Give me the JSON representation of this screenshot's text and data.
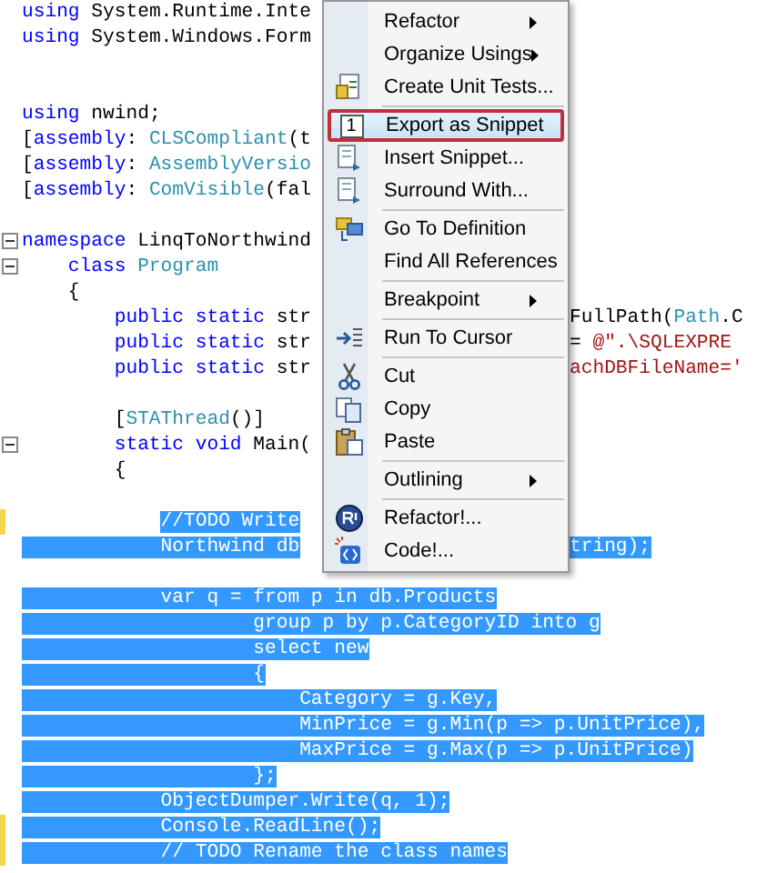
{
  "editor": {
    "lines": [
      {
        "fold": false,
        "changed": false,
        "left": [
          {
            "t": "using",
            "kind": "keyword"
          },
          {
            "t": " System.Runtime.Inte",
            "kind": "plain"
          }
        ]
      },
      {
        "fold": false,
        "changed": false,
        "left": [
          {
            "t": "using",
            "kind": "keyword"
          },
          {
            "t": " System.Windows.Form",
            "kind": "plain"
          }
        ]
      },
      {
        "kind": "blank"
      },
      {
        "kind": "blank"
      },
      {
        "fold": false,
        "changed": false,
        "left": [
          {
            "t": "using",
            "kind": "keyword"
          },
          {
            "t": " nwind;",
            "kind": "plain"
          }
        ]
      },
      {
        "fold": false,
        "changed": false,
        "left": [
          {
            "t": "[",
            "kind": "plain"
          },
          {
            "t": "assembly",
            "kind": "keyword"
          },
          {
            "t": ": ",
            "kind": "plain"
          },
          {
            "t": "CLSCompliant",
            "kind": "type"
          },
          {
            "t": "(t",
            "kind": "plain"
          }
        ]
      },
      {
        "fold": false,
        "changed": false,
        "left": [
          {
            "t": "[",
            "kind": "plain"
          },
          {
            "t": "assembly",
            "kind": "keyword"
          },
          {
            "t": ": ",
            "kind": "plain"
          },
          {
            "t": "AssemblyVersio",
            "kind": "type"
          }
        ]
      },
      {
        "fold": false,
        "changed": false,
        "left": [
          {
            "t": "[",
            "kind": "plain"
          },
          {
            "t": "assembly",
            "kind": "keyword"
          },
          {
            "t": ": ",
            "kind": "plain"
          },
          {
            "t": "ComVisible",
            "kind": "type"
          },
          {
            "t": "(fal",
            "kind": "plain"
          }
        ]
      },
      {
        "kind": "blank"
      },
      {
        "fold": true,
        "changed": false,
        "left": [
          {
            "t": "namespace",
            "kind": "keyword"
          },
          {
            "t": " LinqToNorthwind",
            "kind": "plain"
          }
        ]
      },
      {
        "fold": true,
        "changed": false,
        "left": [
          {
            "t": "    class",
            "kind": "keyword"
          },
          {
            "t": " Program",
            "kind": "type"
          }
        ]
      },
      {
        "fold": false,
        "changed": false,
        "left": [
          {
            "t": "    {",
            "kind": "plain"
          }
        ]
      },
      {
        "fold": false,
        "changed": false,
        "left": [
          {
            "t": "        public static",
            "kind": "keyword"
          },
          {
            "t": " str",
            "kind": "plain"
          }
        ],
        "right": [
          {
            "t": "FullPath(",
            "kind": "plain"
          },
          {
            "t": "Path",
            "kind": "type"
          },
          {
            "t": ".C",
            "kind": "plain"
          }
        ]
      },
      {
        "fold": false,
        "changed": false,
        "left": [
          {
            "t": "        public static",
            "kind": "keyword"
          },
          {
            "t": " str",
            "kind": "plain"
          }
        ],
        "right": [
          {
            "t": "= ",
            "kind": "plain"
          },
          {
            "t": "@\".\\SQLEXPRE",
            "kind": "string"
          }
        ]
      },
      {
        "fold": false,
        "changed": false,
        "left": [
          {
            "t": "        public static",
            "kind": "keyword"
          },
          {
            "t": " str",
            "kind": "plain"
          }
        ],
        "right": [
          {
            "t": "achDBFileName='",
            "kind": "string"
          }
        ]
      },
      {
        "kind": "blank"
      },
      {
        "fold": false,
        "changed": false,
        "left": [
          {
            "t": "        [",
            "kind": "plain"
          },
          {
            "t": "STAThread",
            "kind": "type"
          },
          {
            "t": "()]",
            "kind": "plain"
          }
        ]
      },
      {
        "fold": true,
        "changed": false,
        "left": [
          {
            "t": "        static void",
            "kind": "keyword"
          },
          {
            "t": " Main(",
            "kind": "plain"
          }
        ]
      },
      {
        "fold": false,
        "changed": false,
        "left": [
          {
            "t": "        {",
            "kind": "plain"
          }
        ]
      },
      {
        "kind": "blank"
      },
      {
        "fold": false,
        "changed": true,
        "left": [
          {
            "t": "            //TODO Write",
            "kind": "selection_start"
          }
        ]
      },
      {
        "fold": false,
        "changed": false,
        "left": [
          {
            "t": "            Northwind db",
            "kind": "selected"
          }
        ],
        "right": [
          {
            "t": "tring);",
            "kind": "selected"
          }
        ]
      },
      {
        "kind": "blank"
      },
      {
        "fold": false,
        "changed": false,
        "left": [
          {
            "t": "            var q = from p in db.Products",
            "kind": "selected"
          }
        ]
      },
      {
        "fold": false,
        "changed": false,
        "left": [
          {
            "t": "                    group p by p.CategoryID into g",
            "kind": "selected"
          }
        ]
      },
      {
        "fold": false,
        "changed": false,
        "left": [
          {
            "t": "                    select new",
            "kind": "selected"
          }
        ]
      },
      {
        "fold": false,
        "changed": false,
        "left": [
          {
            "t": "                    {",
            "kind": "selected"
          }
        ]
      },
      {
        "fold": false,
        "changed": false,
        "left": [
          {
            "t": "                        Category = g.Key,",
            "kind": "selected"
          }
        ]
      },
      {
        "fold": false,
        "changed": false,
        "left": [
          {
            "t": "                        MinPrice = g.Min(p => p.UnitPrice),",
            "kind": "selected"
          }
        ]
      },
      {
        "fold": false,
        "changed": false,
        "left": [
          {
            "t": "                        MaxPrice = g.Max(p => p.UnitPrice)",
            "kind": "selected"
          }
        ]
      },
      {
        "fold": false,
        "changed": false,
        "left": [
          {
            "t": "                    };",
            "kind": "selected"
          }
        ]
      },
      {
        "fold": false,
        "changed": false,
        "left": [
          {
            "t": "            ObjectDumper.Write(q, 1);",
            "kind": "selected"
          }
        ]
      },
      {
        "fold": false,
        "changed": true,
        "left": [
          {
            "t": "            Console.ReadLine();",
            "kind": "selected"
          }
        ]
      },
      {
        "fold": false,
        "changed": true,
        "left": [
          {
            "t": "            // TODO Rename the class names",
            "kind": "selected"
          }
        ]
      }
    ]
  },
  "context_menu": {
    "items": [
      {
        "label": "Refactor",
        "submenu": true,
        "selected": false,
        "separator_after": false
      },
      {
        "label": "Organize Usings",
        "submenu": true,
        "selected": false,
        "separator_after": false
      },
      {
        "label": "Create Unit Tests...",
        "submenu": false,
        "selected": false,
        "separator_after": true
      },
      {
        "label": "Export as Snippet",
        "icon_text": "1",
        "submenu": false,
        "selected": true,
        "separator_after": false
      },
      {
        "label": "Insert Snippet...",
        "submenu": false,
        "selected": false,
        "separator_after": false
      },
      {
        "label": "Surround With...",
        "submenu": false,
        "selected": false,
        "separator_after": true
      },
      {
        "label": "Go To Definition",
        "submenu": false,
        "selected": false,
        "separator_after": false
      },
      {
        "label": "Find All References",
        "submenu": false,
        "selected": false,
        "separator_after": true
      },
      {
        "label": "Breakpoint",
        "submenu": true,
        "selected": false,
        "separator_after": true
      },
      {
        "label": "Run To Cursor",
        "submenu": false,
        "selected": false,
        "separator_after": true
      },
      {
        "label": "Cut",
        "submenu": false,
        "selected": false,
        "separator_after": false
      },
      {
        "label": "Copy",
        "submenu": false,
        "selected": false,
        "separator_after": false
      },
      {
        "label": "Paste",
        "submenu": false,
        "selected": false,
        "separator_after": true
      },
      {
        "label": "Outlining",
        "submenu": true,
        "selected": false,
        "separator_after": true
      },
      {
        "label": "Refactor!...",
        "submenu": false,
        "selected": false,
        "separator_after": false
      },
      {
        "label": "Code!...",
        "submenu": false,
        "selected": false,
        "separator_after": false
      }
    ]
  }
}
